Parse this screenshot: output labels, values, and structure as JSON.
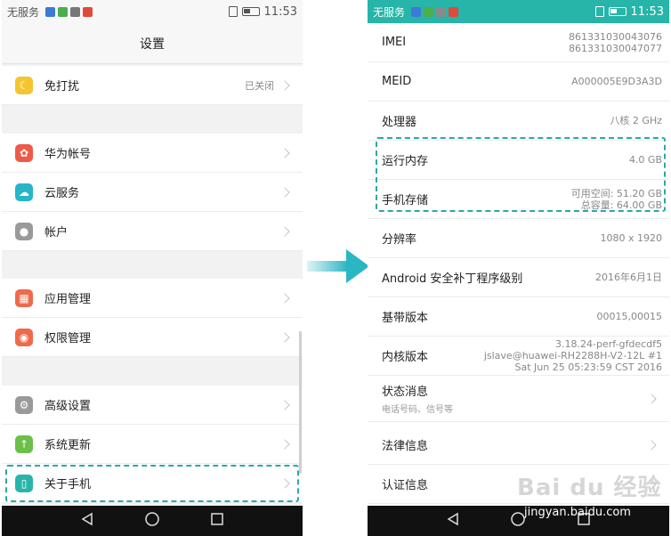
{
  "left": {
    "status": {
      "carrier": "无服务",
      "time": "11:53"
    },
    "title": "设置",
    "items": [
      {
        "label": "免打扰",
        "value": "已关闭",
        "icon": "moon-icon",
        "color": "#f5c530"
      },
      {
        "label": "华为帐号",
        "value": "",
        "icon": "huawei-icon",
        "color": "#ee5a4a"
      },
      {
        "label": "云服务",
        "value": "",
        "icon": "cloud-icon",
        "color": "#28b5c8"
      },
      {
        "label": "帐户",
        "value": "",
        "icon": "user-icon",
        "color": "#9a9a9a"
      },
      {
        "label": "应用管理",
        "value": "",
        "icon": "apps-icon",
        "color": "#ee6a4a"
      },
      {
        "label": "权限管理",
        "value": "",
        "icon": "shield-icon",
        "color": "#ee6a4a"
      },
      {
        "label": "高级设置",
        "value": "",
        "icon": "gear-icon",
        "color": "#9a9a9a"
      },
      {
        "label": "系统更新",
        "value": "",
        "icon": "update-arrow-icon",
        "color": "#6cc04a"
      },
      {
        "label": "关于手机",
        "value": "",
        "icon": "phone-icon",
        "color": "#28b5a8"
      }
    ]
  },
  "right": {
    "status": {
      "carrier": "无服务",
      "time": "11:53"
    },
    "rows": [
      {
        "label": "IMEI",
        "value_lines": [
          "861331030043076",
          "861331030047077"
        ],
        "sub": "",
        "chevron": false
      },
      {
        "label": "MEID",
        "value_lines": [
          "A000005E9D3A3D"
        ],
        "sub": "",
        "chevron": false
      },
      {
        "label": "处理器",
        "value_lines": [
          "八核 2 GHz"
        ],
        "sub": "",
        "chevron": false
      },
      {
        "label": "运行内存",
        "value_lines": [
          "4.0 GB"
        ],
        "sub": "",
        "chevron": false
      },
      {
        "label": "手机存储",
        "value_lines": [
          "可用空间:  51.20  GB",
          "总容量:  64.00  GB"
        ],
        "sub": "",
        "chevron": false
      },
      {
        "label": "分辨率",
        "value_lines": [
          "1080 x 1920"
        ],
        "sub": "",
        "chevron": false
      },
      {
        "label": "Android 安全补丁程序级别",
        "value_lines": [
          "2016年6月1日"
        ],
        "sub": "",
        "chevron": false
      },
      {
        "label": "基带版本",
        "value_lines": [
          "00015,00015"
        ],
        "sub": "",
        "chevron": false
      },
      {
        "label": "内核版本",
        "value_lines": [
          "3.18.24-perf-gfdecdf5",
          "jslave@huawei-RH2288H-V2-12L #1",
          "Sat Jun 25 05:23:59 CST 2016"
        ],
        "sub": "",
        "chevron": false
      },
      {
        "label": "状态消息",
        "value_lines": [],
        "sub": "电话号码、信号等",
        "chevron": true
      },
      {
        "label": "法律信息",
        "value_lines": [],
        "sub": "",
        "chevron": true
      },
      {
        "label": "认证信息",
        "value_lines": [],
        "sub": "",
        "chevron": true
      }
    ]
  },
  "watermark": {
    "logo": "Bai du 经验",
    "url": "jingyan.baidu.com"
  },
  "colors": {
    "accent": "#26b5a8",
    "highlight": "#2aa8a8",
    "arrow": "#2bb6c4"
  }
}
